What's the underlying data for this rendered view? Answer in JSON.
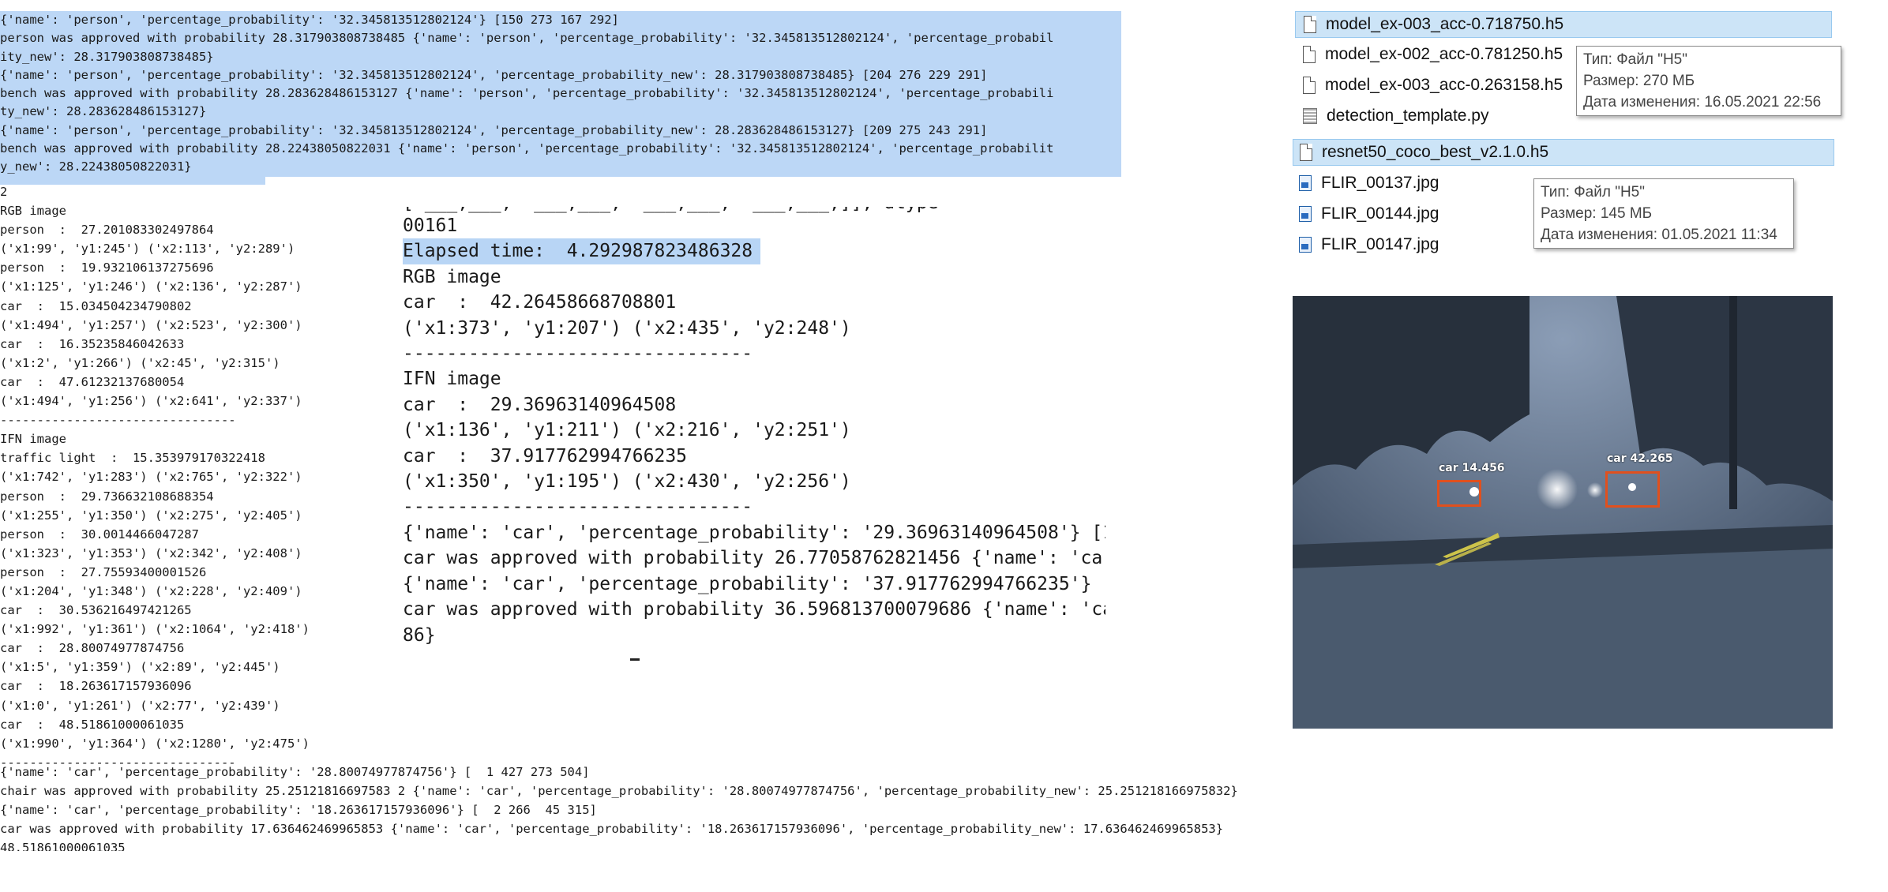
{
  "top_console": {
    "lines": [
      "{'name': 'person', 'percentage_probability': '32.345813512802124'} [150 273 167 292]",
      "person was approved with probability 28.317903808738485 {'name': 'person', 'percentage_probability': '32.345813512802124', 'percentage_probabil",
      "ity_new': 28.317903808738485}",
      "{'name': 'person', 'percentage_probability': '32.345813512802124', 'percentage_probability_new': 28.317903808738485} [204 276 229 291]",
      "bench was approved with probability 28.283628486153127 {'name': 'person', 'percentage_probability': '32.345813512802124', 'percentage_probabili",
      "ty_new': 28.283628486153127}",
      "{'name': 'person', 'percentage_probability': '32.345813512802124', 'percentage_probability_new': 28.283628486153127} [209 275 243 291]",
      "bench was approved with probability 28.22438050822031 {'name': 'person', 'percentage_probability': '32.345813512802124', 'percentage_probabilit",
      "y_new': 28.22438050822031}"
    ]
  },
  "left_console": {
    "lines": [
      "2",
      "RGB image",
      "person  :  27.201083302497864",
      "('x1:99', 'y1:245') ('x2:113', 'y2:289')",
      "person  :  19.932106137275696",
      "('x1:125', 'y1:246') ('x2:136', 'y2:287')",
      "car  :  15.034504234790802",
      "('x1:494', 'y1:257') ('x2:523', 'y2:300')",
      "car  :  16.35235846042633",
      "('x1:2', 'y1:266') ('x2:45', 'y2:315')",
      "car  :  47.61232137680054",
      "('x1:494', 'y1:256') ('x2:641', 'y2:337')",
      "--------------------------------",
      "IFN image",
      "traffic light  :  15.353979170322418",
      "('x1:742', 'y1:283') ('x2:765', 'y2:322')",
      "person  :  29.736632108688354",
      "('x1:255', 'y1:350') ('x2:275', 'y2:405')",
      "person  :  30.0014466047287",
      "('x1:323', 'y1:353') ('x2:342', 'y2:408')",
      "person  :  27.75593400001526",
      "('x1:204', 'y1:348') ('x2:228', 'y2:409')",
      "car  :  30.536216497421265",
      "('x1:992', 'y1:361') ('x2:1064', 'y2:418')",
      "car  :  28.80074977874756",
      "('x1:5', 'y1:359') ('x2:89', 'y2:445')",
      "car  :  18.263617157936096",
      "('x1:0', 'y1:261') ('x2:77', 'y2:439')",
      "car  :  48.51861000061035",
      "('x1:990', 'y1:364') ('x2:1280', 'y2:475')",
      "--------------------------------"
    ]
  },
  "mid_console": {
    "clipped_top": "[ ___,___,  ___,___,  ___,___,  ___,___,]], dtype=",
    "line0": "00161",
    "elapsed": "Elapsed time:  4.292987823486328",
    "lines": [
      "RGB image",
      "car  :  42.26458668708801",
      "('x1:373', 'y1:207') ('x2:435', 'y2:248')",
      "--------------------------------",
      "IFN image",
      "car  :  29.36963140964508",
      "('x1:136', 'y1:211') ('x2:216', 'y2:251')",
      "car  :  37.917762994766235",
      "('x1:350', 'y1:195') ('x2:430', 'y2:256')",
      "--------------------------------",
      "{'name': 'car', 'percentage_probability': '29.36963140964508'} [1",
      "car was approved with probability 26.77058762821456 {'name': 'car",
      "{'name': 'car', 'percentage_probability': '37.917762994766235'} [",
      "car was approved with probability 36.596813700079686 {'name': 'ca",
      "86}"
    ]
  },
  "bottom_console": {
    "lines": [
      "{'name': 'car', 'percentage_probability': '28.80074977874756'} [  1 427 273 504]",
      "chair was approved with probability 25.25121816697583 2 {'name': 'car', 'percentage_probability': '28.80074977874756', 'percentage_probability_new': 25.251218166975832}",
      "{'name': 'car', 'percentage_probability': '18.263617157936096'} [  2 266  45 315]",
      "car was approved with probability 17.636462469965853 {'name': 'car', 'percentage_probability': '18.263617157936096', 'percentage_probability_new': 17.636462469965853}",
      "48.51861000061035"
    ]
  },
  "explorer_top": {
    "files": [
      {
        "name": "model_ex-003_acc-0.718750.h5",
        "icon": "file-icon",
        "selected": true
      },
      {
        "name": "model_ex-002_acc-0.781250.h5",
        "icon": "file-icon",
        "selected": false
      },
      {
        "name": "model_ex-003_acc-0.263158.h5",
        "icon": "file-icon",
        "selected": false
      },
      {
        "name": "detection_template.py",
        "icon": "python-file-icon",
        "selected": false
      }
    ],
    "tooltip": {
      "type": "Тип: Файл \"H5\"",
      "size": "Размер: 270 МБ",
      "modified": "Дата изменения: 16.05.2021 22:56"
    }
  },
  "explorer_bottom": {
    "files": [
      {
        "name": "resnet50_coco_best_v2.1.0.h5",
        "icon": "file-icon",
        "selected": true
      },
      {
        "name": "FLIR_00137.jpg",
        "icon": "image-file-icon",
        "selected": false
      },
      {
        "name": "FLIR_00144.jpg",
        "icon": "image-file-icon",
        "selected": false
      },
      {
        "name": "FLIR_00147.jpg",
        "icon": "image-file-icon",
        "selected": false
      }
    ],
    "tooltip": {
      "type": "Тип: Файл \"H5\"",
      "size": "Размер: 145 МБ",
      "modified": "Дата изменения: 01.05.2021 11:34"
    }
  },
  "photo": {
    "detections": [
      {
        "label": "car 14.456"
      },
      {
        "label": "car 42.265"
      }
    ],
    "box_color": "#e0501e"
  }
}
